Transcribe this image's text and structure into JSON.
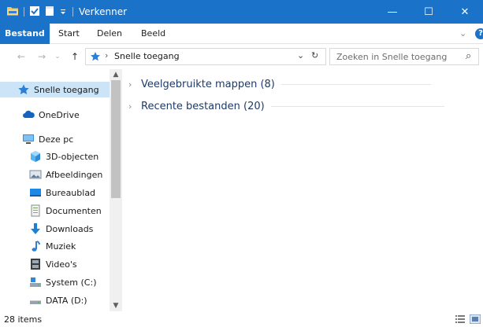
{
  "window": {
    "title": "Verkenner",
    "minimize_glyph": "—",
    "maximize_glyph": "☐",
    "close_glyph": "✕"
  },
  "ribbon": {
    "tabs": [
      {
        "label": "Bestand",
        "active": true
      },
      {
        "label": "Start"
      },
      {
        "label": "Delen"
      },
      {
        "label": "Beeld"
      }
    ],
    "expand_glyph": "⌄",
    "help_glyph": "?"
  },
  "navigation": {
    "back_glyph": "←",
    "forward_glyph": "→",
    "recent_glyph": "⌄",
    "up_glyph": "↑"
  },
  "address": {
    "separator": "›",
    "path": "Snelle toegang",
    "dropdown_glyph": "⌄",
    "refresh_glyph": "↻"
  },
  "search": {
    "placeholder": "Zoeken in Snelle toegang",
    "icon_glyph": "⌕"
  },
  "nav_pane": {
    "items": [
      {
        "label": "Snelle toegang",
        "icon": "star-icon",
        "selected": true
      },
      {
        "label": "OneDrive",
        "icon": "cloud-icon"
      },
      {
        "label": "Deze pc",
        "icon": "monitor-icon"
      },
      {
        "label": "3D-objecten",
        "icon": "cube-icon"
      },
      {
        "label": "Afbeeldingen",
        "icon": "pictures-icon"
      },
      {
        "label": "Bureaublad",
        "icon": "desktop-icon"
      },
      {
        "label": "Documenten",
        "icon": "documents-icon"
      },
      {
        "label": "Downloads",
        "icon": "download-icon"
      },
      {
        "label": "Muziek",
        "icon": "music-icon"
      },
      {
        "label": "Video's",
        "icon": "film-icon"
      },
      {
        "label": "System (C:)",
        "icon": "drive-icon"
      },
      {
        "label": "DATA (D:)",
        "icon": "drive-icon"
      }
    ]
  },
  "groups": [
    {
      "label": "Veelgebruikte mappen (8)"
    },
    {
      "label": "Recente bestanden (20)"
    }
  ],
  "status": {
    "count": "28 items"
  },
  "colors": {
    "accent": "#1a73c9",
    "selection": "#cce4f7"
  }
}
